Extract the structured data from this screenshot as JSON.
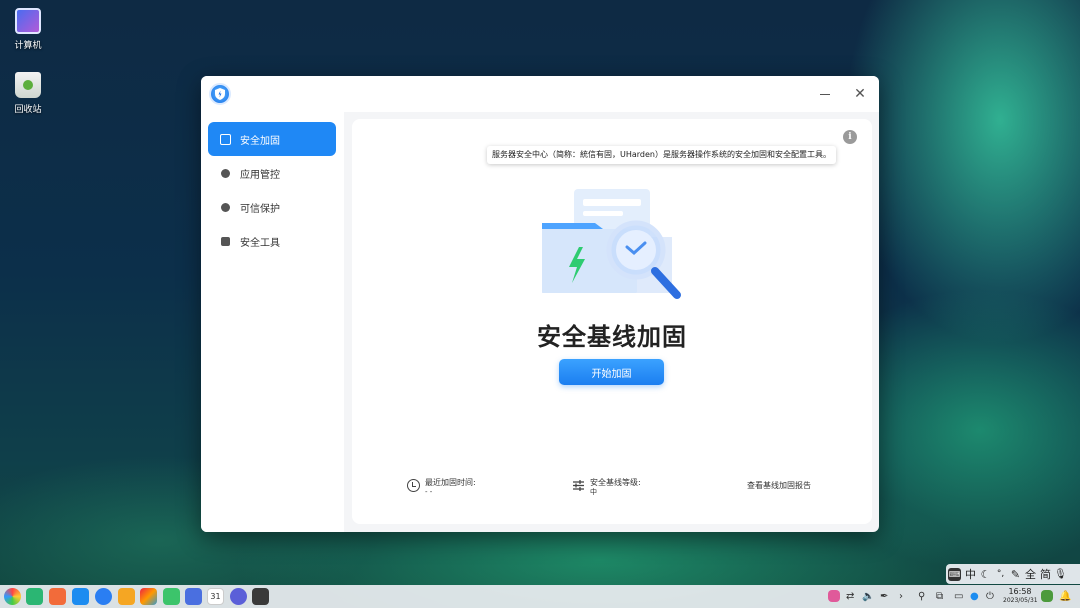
{
  "desktop": {
    "icons": [
      {
        "label": "计算机"
      },
      {
        "label": "回收站"
      }
    ]
  },
  "window": {
    "sidebar": {
      "items": [
        {
          "label": "安全加固",
          "active": true
        },
        {
          "label": "应用管控",
          "active": false
        },
        {
          "label": "可信保护",
          "active": false
        },
        {
          "label": "安全工具",
          "active": false
        }
      ]
    },
    "main": {
      "tooltip": "服务器安全中心（简称：統信有固，UHarden）是服务器操作系统的安全加固和安全配置工具。",
      "title": "安全基线加固",
      "start_button": "开始加固",
      "footer": {
        "last_time_label": "最近加固时间:",
        "last_time_value": "- -",
        "level_label": "安全基线等级:",
        "level_value": "中",
        "report_link": "查看基线加固报告"
      }
    },
    "colors": {
      "accent": "#1f88f5",
      "illustration_green": "#2ecc71"
    }
  },
  "ime": {
    "items": [
      "中",
      "全",
      "简"
    ]
  },
  "taskbar": {
    "clock_time": "16:58",
    "clock_date": "2023/05/31",
    "calendar_day": "31"
  }
}
